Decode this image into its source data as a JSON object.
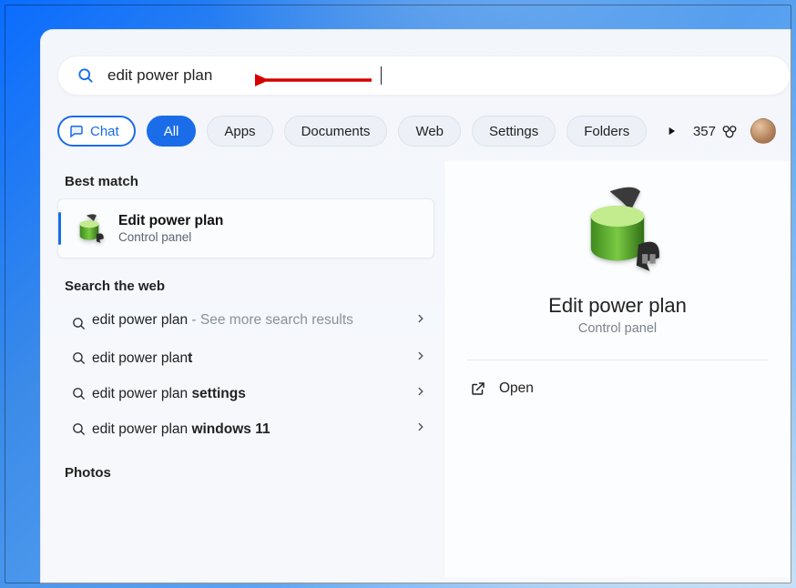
{
  "search": {
    "query": "edit power plan"
  },
  "filters": {
    "chat": "Chat",
    "all": "All",
    "apps": "Apps",
    "documents": "Documents",
    "web": "Web",
    "settings": "Settings",
    "folders": "Folders"
  },
  "rewards": {
    "points": "357"
  },
  "sections": {
    "best_match": "Best match",
    "search_web": "Search the web",
    "photos": "Photos"
  },
  "best_match": {
    "title": "Edit power plan",
    "subtitle": "Control panel"
  },
  "web_results": [
    {
      "prefix": "edit power plan",
      "suffix": " - See more search results",
      "bold": ""
    },
    {
      "prefix": "edit power plan",
      "suffix": "",
      "bold": "t"
    },
    {
      "prefix": "edit power plan ",
      "suffix": "",
      "bold": "settings"
    },
    {
      "prefix": "edit power plan ",
      "suffix": "",
      "bold": "windows 11"
    }
  ],
  "preview": {
    "title": "Edit power plan",
    "subtitle": "Control panel",
    "open": "Open"
  },
  "colors": {
    "accent": "#1a6ce8"
  }
}
